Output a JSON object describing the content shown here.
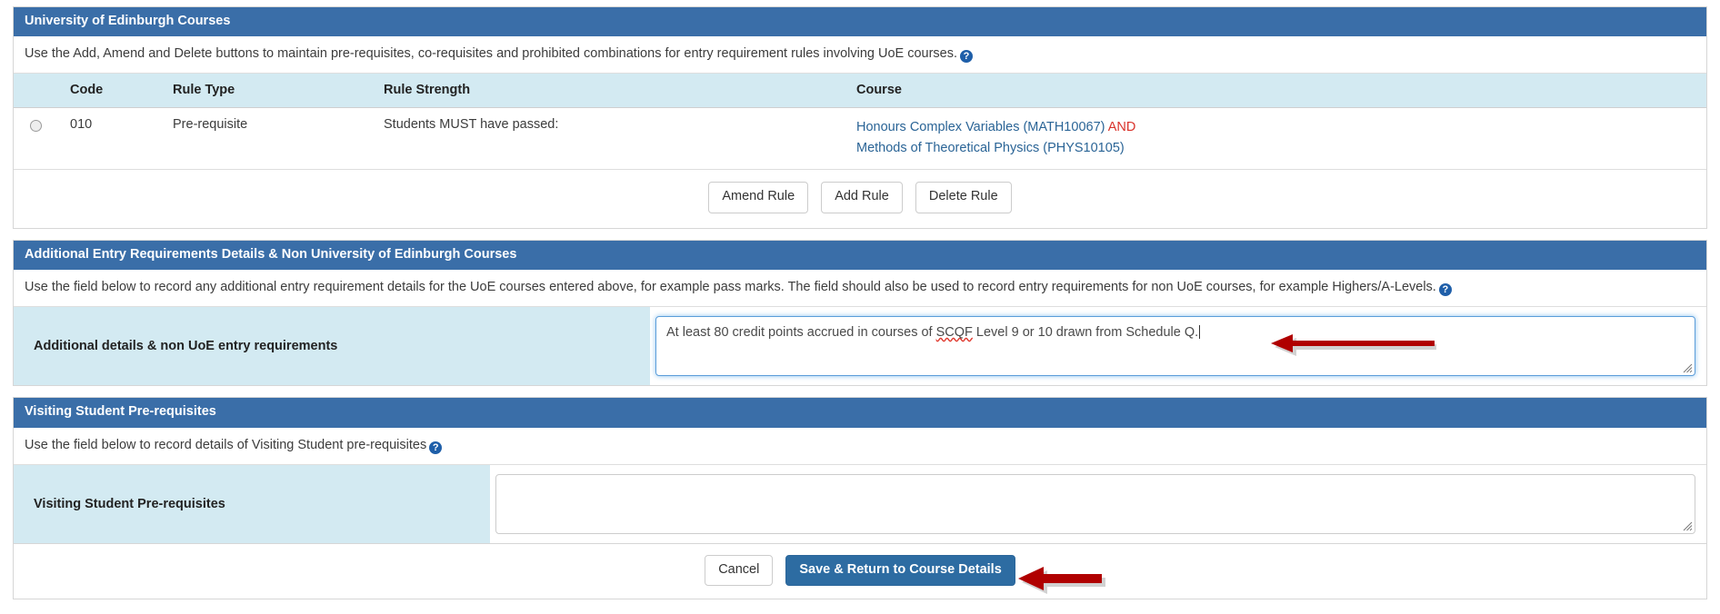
{
  "panels": {
    "uoe_courses": {
      "heading": "University of Edinburgh Courses",
      "description": "Use the Add, Amend and Delete buttons to maintain pre-requisites, co-requisites and prohibited combinations for entry requirement rules involving UoE courses.",
      "help_icon": "help-circle-icon",
      "table": {
        "columns": [
          "",
          "Code",
          "Rule Type",
          "Rule Strength",
          "Course"
        ],
        "rows": [
          {
            "selected": false,
            "code": "010",
            "rule_type": "Pre-requisite",
            "rule_strength": "Students MUST have passed:",
            "courses": [
              {
                "name": "Honours Complex Variables (MATH10067)",
                "connector": "AND"
              },
              {
                "name": "Methods of Theoretical Physics (PHYS10105)",
                "connector": ""
              }
            ]
          }
        ]
      },
      "buttons": {
        "amend": "Amend Rule",
        "add": "Add Rule",
        "delete": "Delete Rule"
      }
    },
    "additional_details": {
      "heading": "Additional Entry Requirements Details & Non University of Edinburgh Courses",
      "description": "Use the field below to record any additional entry requirement details for the UoE courses entered above, for example pass marks. The field should also be used to record entry requirements for non UoE courses, for example Highers/A-Levels.",
      "help_icon": "help-circle-icon",
      "field": {
        "label": "Additional details & non UoE entry requirements",
        "value_before_spell": "At least 80 credit points accrued in courses of ",
        "value_spell_word": "SCQF",
        "value_after_spell": " Level 9 or 10 drawn from Schedule Q.",
        "placeholder": "",
        "focused": true
      }
    },
    "visiting_student": {
      "heading": "Visiting Student Pre-requisites",
      "description": "Use the field below to record details of Visiting Student pre-requisites",
      "help_icon": "help-circle-icon",
      "field": {
        "label": "Visiting Student Pre-requisites",
        "value": "",
        "placeholder": "",
        "focused": false
      }
    }
  },
  "footer": {
    "cancel_label": "Cancel",
    "save_label": "Save & Return to Course Details"
  },
  "annotations": {
    "arrow_color": "#b00000",
    "arrow_textarea_name": "red-arrow-pointing-to-additional-details-field",
    "arrow_save_name": "red-arrow-pointing-to-save-button"
  },
  "colors": {
    "panel_heading_bg": "#3a6ea8",
    "table_header_bg": "#d3eaf2",
    "link": "#2a6496",
    "connector": "#d9322a",
    "primary_button": "#2d6ca2"
  }
}
